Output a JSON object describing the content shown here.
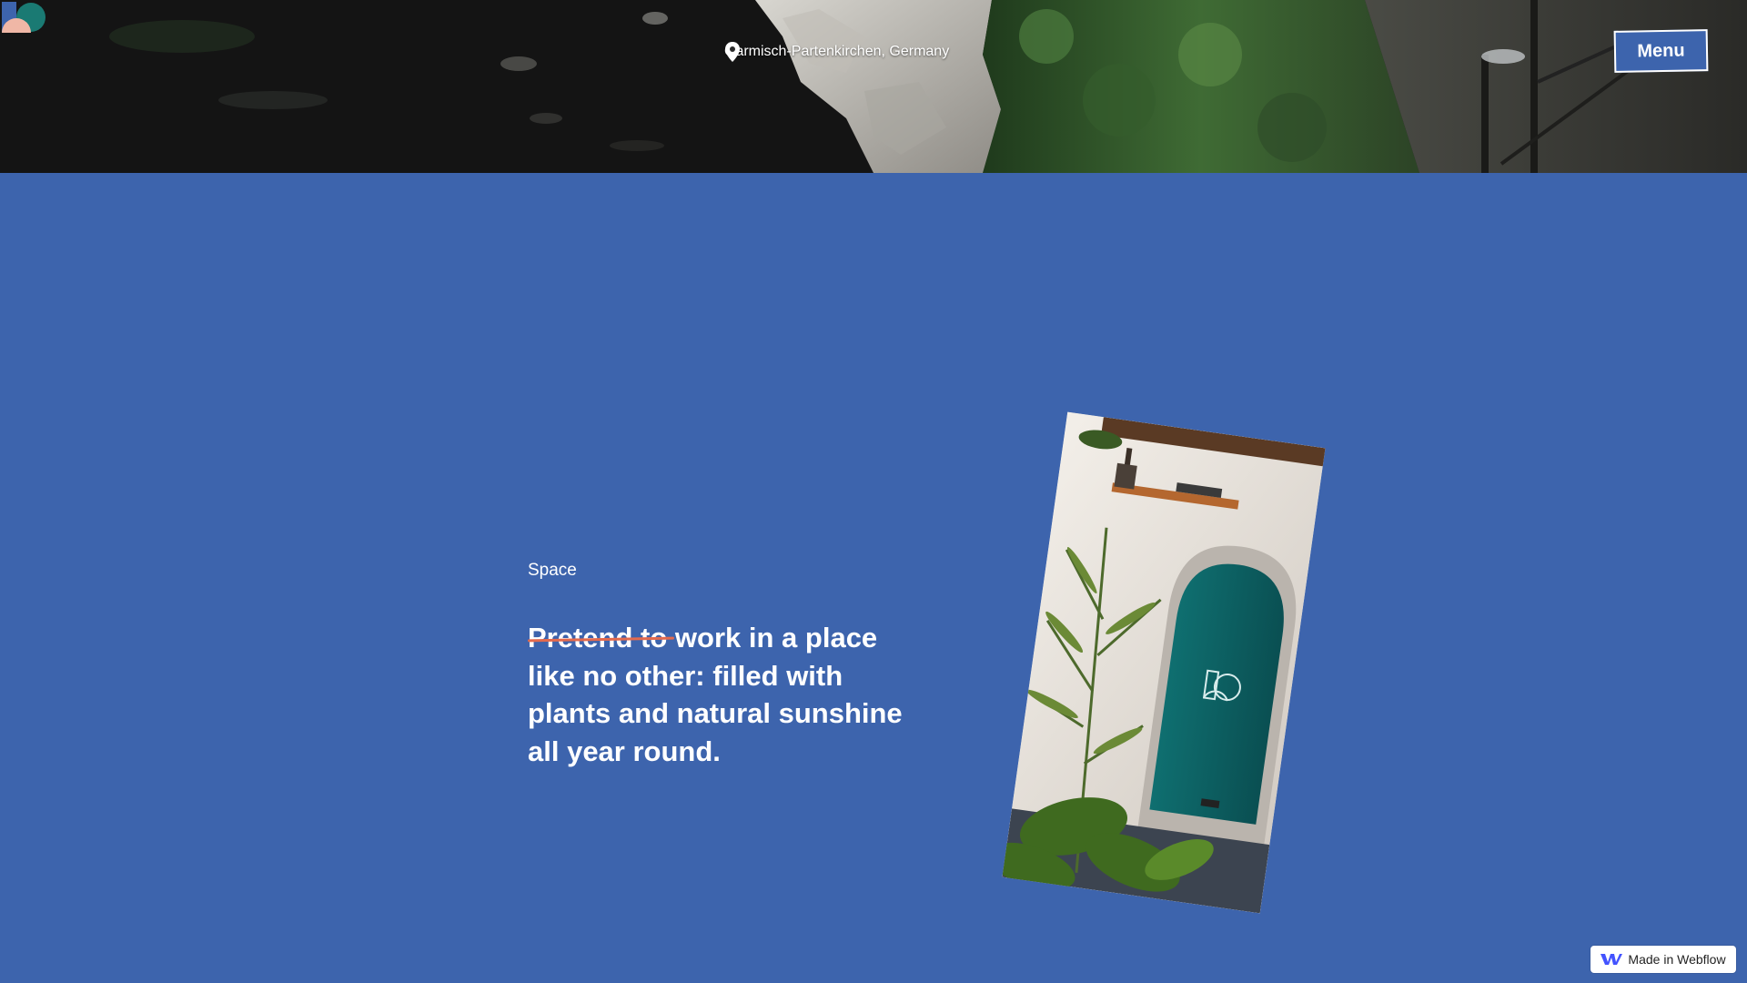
{
  "colors": {
    "background": "#3d64ad",
    "text": "#ffffff",
    "strike_accent": "#e36a4e"
  },
  "header": {
    "logo_icon": "ko-logo-icon",
    "location_icon": "map-pin-icon",
    "location": "Garmisch-Partenkirchen, Germany",
    "menu_label": "Menu"
  },
  "main": {
    "section_label": "Space",
    "headline_struck": "Pretend to",
    "headline_rest": "work in a place like no other: filled with plants and natural sunshine all year round.",
    "photo_icon": "ko-door-emblem-icon"
  },
  "badge": {
    "icon": "webflow-logo-icon",
    "label": "Made in Webflow"
  }
}
